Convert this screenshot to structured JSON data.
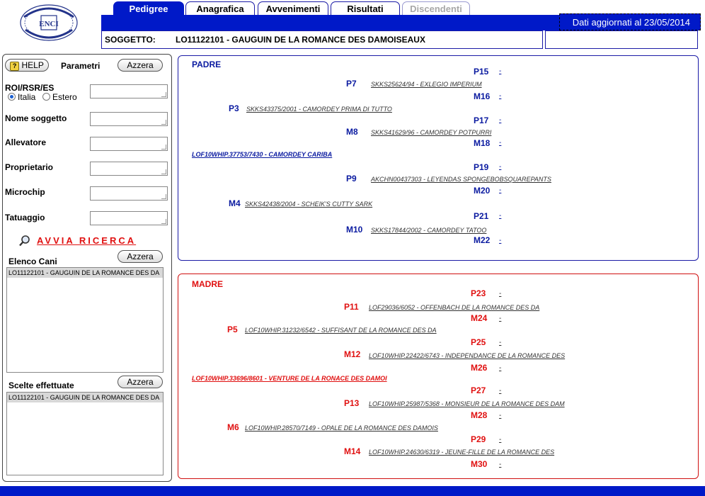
{
  "tabs": [
    {
      "label": "Pedigree",
      "state": "active"
    },
    {
      "label": "Anagrafica",
      "state": "normal"
    },
    {
      "label": "Avvenimenti",
      "state": "normal"
    },
    {
      "label": "Risultati",
      "state": "normal"
    },
    {
      "label": "Discendenti",
      "state": "disabled"
    }
  ],
  "header": {
    "update_text": "Dati aggiornati al 23/05/2014",
    "subject_label": "SOGGETTO:",
    "subject_value": "LO11122101 - GAUGUIN DE LA ROMANCE DES DAMOISEAUX"
  },
  "logo": {
    "text": "ENCI"
  },
  "left": {
    "help_label": "HELP",
    "params_label": "Parametri",
    "reset_label": "Azzera",
    "roi_label": "ROI/RSR/ES",
    "radio_italia": "Italia",
    "radio_estero": "Estero",
    "nome_label": "Nome soggetto",
    "allevatore_label": "Allevatore",
    "proprietario_label": "Proprietario",
    "microchip_label": "Microchip",
    "tatuaggio_label": "Tatuaggio",
    "search_label": "AVVIA RICERCA",
    "elenco_label": "Elenco Cani",
    "elenco_items": [
      "LO11122101 - GAUGUIN DE LA ROMANCE DES DA"
    ],
    "scelte_label": "Scelte effettuate",
    "scelte_items": [
      "LO11122101 - GAUGUIN DE LA ROMANCE DES DA"
    ]
  },
  "padre": {
    "title": "PADRE",
    "main": "LOF10WHIP.37753/7430 - CAMORDEY CARIBA",
    "p3": {
      "code": "P3",
      "dog": "SKKS43375/2001 - CAMORDEY PRIMA DI TUTTO"
    },
    "m4": {
      "code": "M4",
      "dog": "SKKS42438/2004 - SCHEIK'S CUTTY SARK"
    },
    "p7": {
      "code": "P7",
      "dog": "SKKS25624/94 - EXLEGIO IMPERIUM"
    },
    "m8": {
      "code": "M8",
      "dog": "SKKS41629/96 - CAMORDEY POTPURRI"
    },
    "p9": {
      "code": "P9",
      "dog": "AKCHN00437303 - LEYENDAS SPONGEBOBSQUAREPANTS"
    },
    "m10": {
      "code": "M10",
      "dog": "SKKS17844/2002 - CAMORDEY TATOO"
    },
    "g": {
      "p15": "P15",
      "m16": "M16",
      "p17": "P17",
      "m18": "M18",
      "p19": "P19",
      "m20": "M20",
      "p21": "P21",
      "m22": "M22"
    },
    "dash": "-"
  },
  "madre": {
    "title": "MADRE",
    "main": "LOF10WHIP.33696/8601 - VENTURE DE LA RONACE DES DAMOI",
    "p5": {
      "code": "P5",
      "dog": "LOF10WHIP.31232/6542 - SUFFISANT DE LA ROMANCE DES DA"
    },
    "m6": {
      "code": "M6",
      "dog": "LOF10WHIP.28570/7149 - OPALE DE LA ROMANCE DES DAMOIS"
    },
    "p11": {
      "code": "P11",
      "dog": "LOF29036/6052 - OFFENBACH DE LA ROMANCE DES DA"
    },
    "m12": {
      "code": "M12",
      "dog": "LOF10WHIP.22422/6743 - INDEPENDANCE DE LA ROMANCE DES"
    },
    "p13": {
      "code": "P13",
      "dog": "LOF10WHIP.25987/5368 - MONSIEUR DE LA ROMANCE DES DAM"
    },
    "m14": {
      "code": "M14",
      "dog": "LOF10WHIP.24630/6319 - JEUNE-FILLE DE LA ROMANCE DES"
    },
    "g": {
      "p23": "P23",
      "m24": "M24",
      "p25": "P25",
      "m26": "M26",
      "p27": "P27",
      "m28": "M28",
      "p29": "P29",
      "m30": "M30"
    },
    "dash": "-"
  },
  "colors": {
    "brand_blue": "#0019c8",
    "sire_blue": "#0a1aa0",
    "dam_red": "#e01010"
  }
}
